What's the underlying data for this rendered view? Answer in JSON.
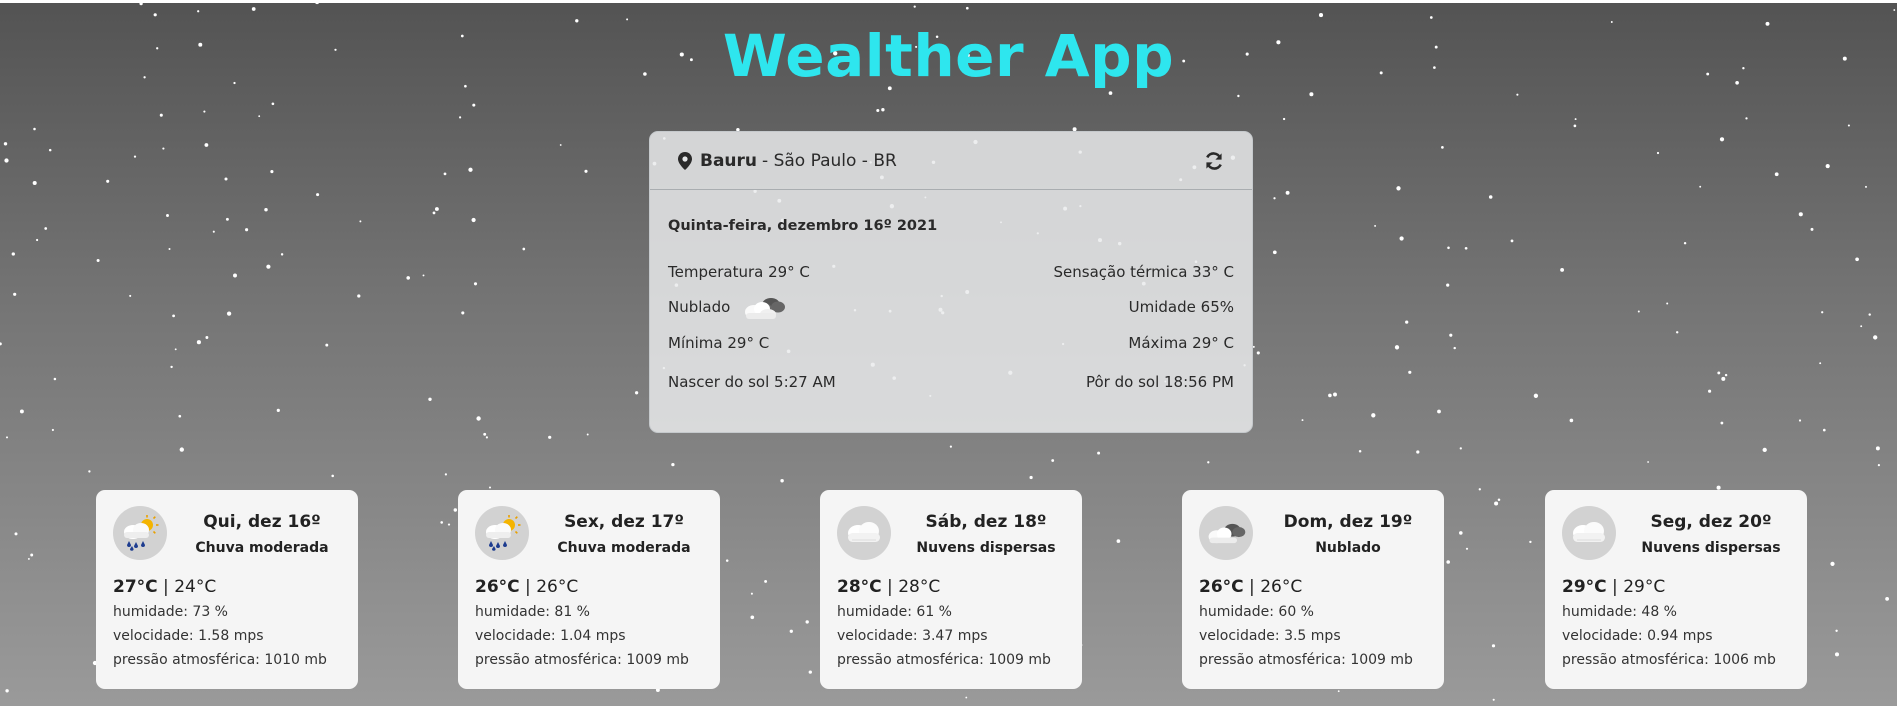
{
  "app": {
    "title": "Wealther App"
  },
  "current": {
    "city": "Bauru",
    "region": "- São Paulo - BR",
    "date": "Quinta-feira, dezembro 16º 2021",
    "temperature": "Temperatura 29° C",
    "feels_like": "Sensação térmica 33° C",
    "condition": "Nublado",
    "humidity": "Umidade 65%",
    "min": "Mínima 29° C",
    "max": "Máxima 29° C",
    "sunrise": "Nascer do sol 5:27 AM",
    "sunset": "Pôr do sol 18:56 PM",
    "icons": {
      "location": "map-pin-icon",
      "refresh": "refresh-icon",
      "condition": "cloudy-icon"
    }
  },
  "forecast": [
    {
      "date": "Qui, dez 16º",
      "desc": "Chuva moderada",
      "temp_max": "27°C",
      "sep": "|",
      "temp_min": "24°C",
      "humidity": "humidade: 73 %",
      "speed": "velocidade: 1.58 mps",
      "pressure": "pressão atmosférica: 1010 mb",
      "icon": "rain-sun-icon"
    },
    {
      "date": "Sex, dez 17º",
      "desc": "Chuva moderada",
      "temp_max": "26°C",
      "sep": "|",
      "temp_min": "26°C",
      "humidity": "humidade: 81 %",
      "speed": "velocidade: 1.04 mps",
      "pressure": "pressão atmosférica: 1009 mb",
      "icon": "rain-sun-icon"
    },
    {
      "date": "Sáb, dez 18º",
      "desc": "Nuvens dispersas",
      "temp_max": "28°C",
      "sep": "|",
      "temp_min": "28°C",
      "humidity": "humidade: 61 %",
      "speed": "velocidade: 3.47 mps",
      "pressure": "pressão atmosférica: 1009 mb",
      "icon": "cloud-icon"
    },
    {
      "date": "Dom, dez 19º",
      "desc": "Nublado",
      "temp_max": "26°C",
      "sep": "|",
      "temp_min": "26°C",
      "humidity": "humidade: 60 %",
      "speed": "velocidade: 3.5 mps",
      "pressure": "pressão atmosférica: 1009 mb",
      "icon": "cloudy-icon"
    },
    {
      "date": "Seg, dez 20º",
      "desc": "Nuvens dispersas",
      "temp_max": "29°C",
      "sep": "|",
      "temp_min": "29°C",
      "humidity": "humidade: 48 %",
      "speed": "velocidade: 0.94 mps",
      "pressure": "pressão atmosférica: 1006 mb",
      "icon": "cloud-icon"
    }
  ],
  "colors": {
    "title": "#2ee6ee",
    "card": "#e9ebec",
    "forecast_card": "#f5f5f5",
    "icon_bg": "#d2d2d2"
  }
}
